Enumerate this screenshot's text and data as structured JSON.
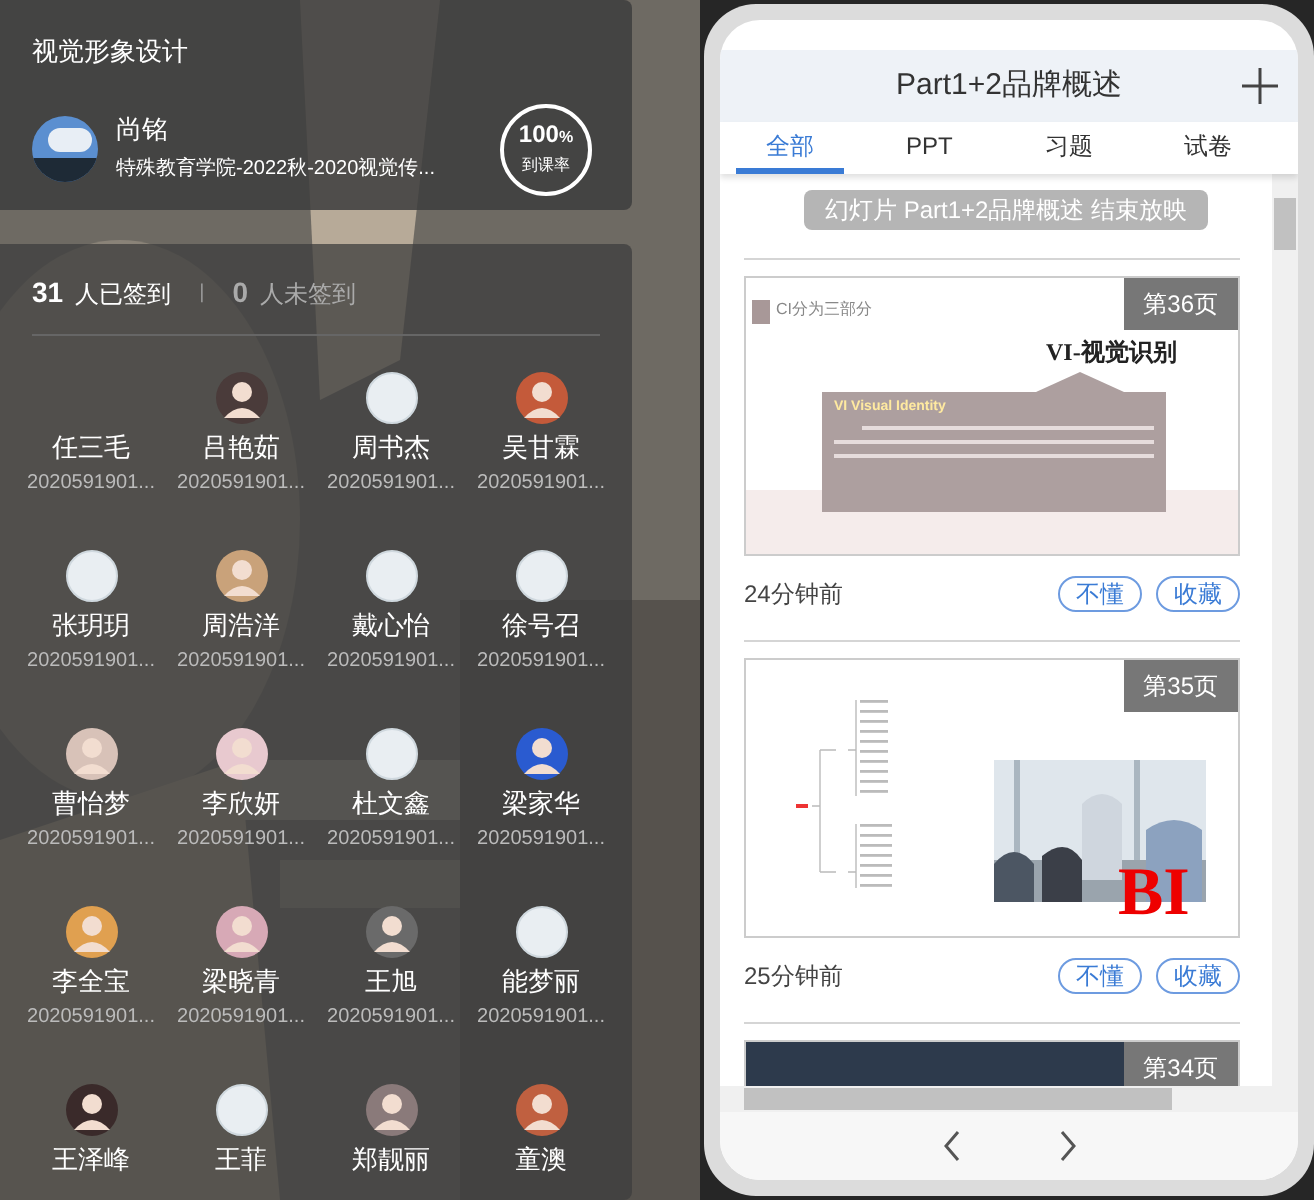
{
  "course": {
    "title": "视觉形象设计",
    "teacher": "尚铭",
    "class": "特殊教育学院-2022秋-2020视觉传...",
    "rate": "100",
    "rate_unit": "%",
    "rate_label": "到课率"
  },
  "attendance": {
    "signed_count": "31",
    "signed_label": "人已签到",
    "separator": "|",
    "unsigned_count": "0",
    "unsigned_label": "人未签到"
  },
  "students": [
    {
      "name": "任三毛",
      "id": "2020591901...",
      "kind": "no_avatar"
    },
    {
      "name": "吕艳茹",
      "id": "2020591901...",
      "kind": "photo_avatar"
    },
    {
      "name": "周书杰",
      "id": "2020591901...",
      "kind": "default_avatar"
    },
    {
      "name": "吴甘霖",
      "id": "2020591901...",
      "kind": "photo_avatar"
    },
    {
      "name": "张玥玥",
      "id": "2020591901...",
      "kind": "default_avatar"
    },
    {
      "name": "周浩洋",
      "id": "2020591901...",
      "kind": "photo_avatar"
    },
    {
      "name": "戴心怡",
      "id": "2020591901...",
      "kind": "default_avatar"
    },
    {
      "name": "徐号召",
      "id": "2020591901...",
      "kind": "default_avatar"
    },
    {
      "name": "曹怡梦",
      "id": "2020591901...",
      "kind": "photo_avatar"
    },
    {
      "name": "李欣妍",
      "id": "2020591901...",
      "kind": "photo_avatar"
    },
    {
      "name": "杜文鑫",
      "id": "2020591901...",
      "kind": "default_avatar"
    },
    {
      "name": "梁家华",
      "id": "2020591901...",
      "kind": "photo_avatar"
    },
    {
      "name": "李全宝",
      "id": "2020591901...",
      "kind": "photo_avatar"
    },
    {
      "name": "梁晓青",
      "id": "2020591901...",
      "kind": "photo_avatar"
    },
    {
      "name": "王旭",
      "id": "2020591901...",
      "kind": "photo_avatar"
    },
    {
      "name": "能梦丽",
      "id": "2020591901...",
      "kind": "default_avatar"
    },
    {
      "name": "王泽峰",
      "kind": "photo_avatar"
    },
    {
      "name": "王菲",
      "kind": "default_avatar"
    },
    {
      "name": "郑靓丽",
      "kind": "photo_avatar"
    },
    {
      "name": "童澳",
      "kind": "photo_avatar"
    }
  ],
  "panel": {
    "title": "Part1+2品牌概述",
    "tabs": [
      {
        "label": "全部",
        "selected": true
      },
      {
        "label": "PPT",
        "selected": false
      },
      {
        "label": "习题",
        "selected": false
      },
      {
        "label": "试卷",
        "selected": false
      }
    ],
    "notice": "幻灯片 Part1+2品牌概述 结束放映",
    "slides": [
      {
        "page": "第36页",
        "kind": "vi",
        "heading": "CI分为三部分",
        "title": "VI-视觉识别",
        "box_title": "VI  Visual Identity",
        "time": "24分钟前",
        "buttons": [
          "不懂",
          "收藏"
        ]
      },
      {
        "page": "第35页",
        "kind": "bi",
        "mark": "BI",
        "time": "25分钟前",
        "buttons": [
          "不懂",
          "收藏"
        ]
      },
      {
        "page": "第34页",
        "kind": "dark"
      }
    ]
  }
}
